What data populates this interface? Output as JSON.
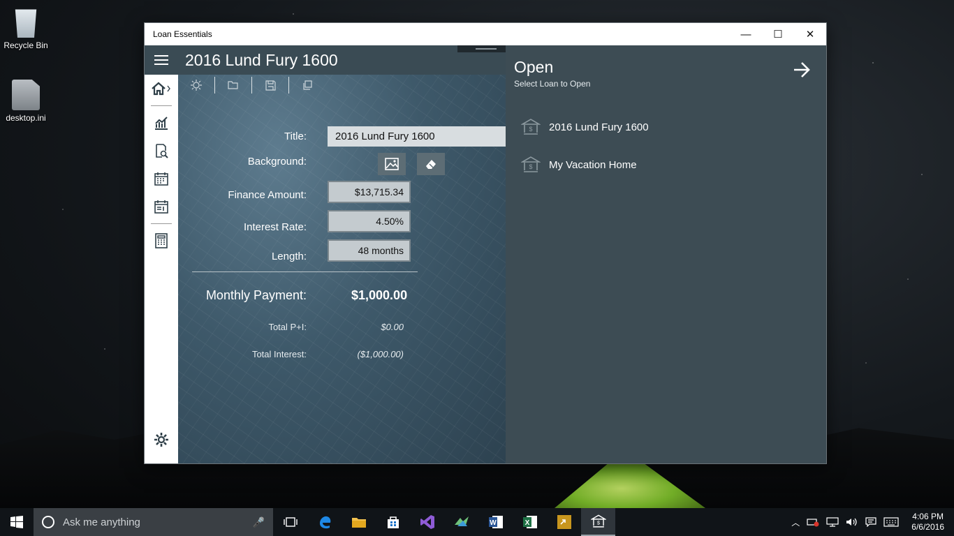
{
  "desktop": {
    "icons": [
      {
        "label": "Recycle Bin"
      },
      {
        "label": "desktop.ini"
      }
    ]
  },
  "window": {
    "title": "Loan Essentials",
    "minimize": "—",
    "maximize": "☐",
    "close": "✕"
  },
  "app": {
    "loan_title": "2016 Lund Fury 1600",
    "form": {
      "title_label": "Title:",
      "title_value": "2016 Lund Fury 1600",
      "background_label": "Background:",
      "finance_label": "Finance Amount:",
      "finance_value": "$13,715.34",
      "interest_label": "Interest Rate:",
      "interest_value": "4.50%",
      "length_label": "Length:",
      "length_value": "48 months",
      "monthly_label": "Monthly Payment:",
      "monthly_value": "$1,000.00",
      "total_pi_label": "Total P+I:",
      "total_pi_value": "$0.00",
      "total_interest_label": "Total Interest:",
      "total_interest_value": "($1,000.00)"
    },
    "open_panel": {
      "title": "Open",
      "subtitle": "Select Loan to Open",
      "loans": [
        "2016 Lund Fury 1600",
        "My Vacation Home"
      ]
    }
  },
  "taskbar": {
    "search_placeholder": "Ask me anything",
    "time": "4:06 PM",
    "date": "6/6/2016"
  }
}
